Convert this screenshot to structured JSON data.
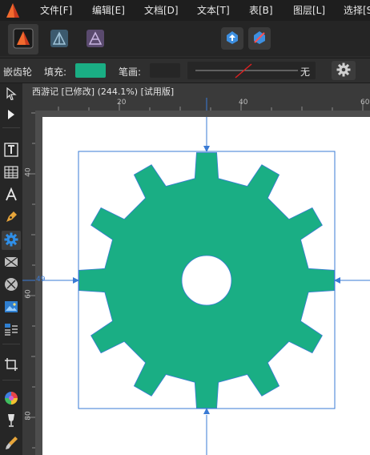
{
  "menu": {
    "items": [
      "文件[F]",
      "编辑[E]",
      "文档[D]",
      "文本[T]",
      "表[B]",
      "图层[L]",
      "选择[S"
    ]
  },
  "personas": [
    "designer-persona",
    "pixel-persona",
    "export-persona"
  ],
  "context_toolbar": {
    "tool_name": "嵌齿轮",
    "fill_label": "填充:",
    "stroke_label": "笔画:",
    "stroke_width_value": "无",
    "fill_color": "#1aae84"
  },
  "document": {
    "tab_title": "西游记 [已修改] (244.1%) [试用版]"
  },
  "rulers": {
    "horizontal": [
      "20",
      "40",
      "60"
    ],
    "vertical": [
      "40",
      "60",
      "80"
    ],
    "vertical_marker": "49"
  },
  "shape": {
    "type": "cog",
    "teeth": 12,
    "fill": "#1aae84",
    "selection_color": "#3a7bd5"
  },
  "tools": [
    "move-tool",
    "node-tool",
    "frame-text-tool",
    "table-tool",
    "artistic-text-tool",
    "pen-tool",
    "cog-tool",
    "shape-tool",
    "circle-shape-tool",
    "image-tool",
    "place-tool",
    "crop-tool",
    "color-picker-tool",
    "fill-tool",
    "brush-tool"
  ]
}
